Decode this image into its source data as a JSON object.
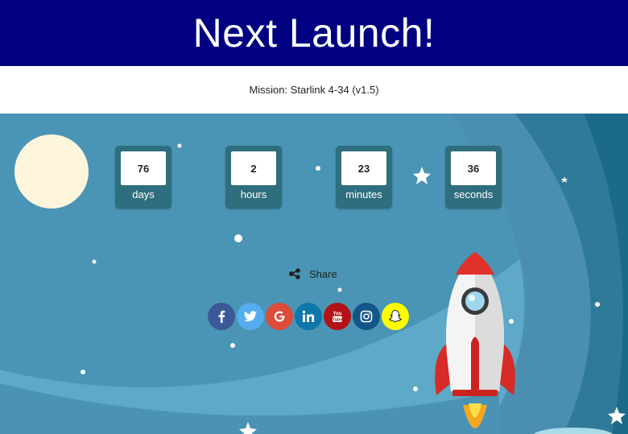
{
  "header": {
    "title": "Next Launch!"
  },
  "mission": {
    "text": "Mission: Starlink 4-34 (v1.5)"
  },
  "countdown": [
    {
      "value": "76",
      "unit": "days"
    },
    {
      "value": "2",
      "unit": "hours"
    },
    {
      "value": "23",
      "unit": "minutes"
    },
    {
      "value": "36",
      "unit": "seconds"
    }
  ],
  "share": {
    "label": "Share",
    "icon": "share-icon"
  },
  "social": [
    {
      "name": "facebook",
      "icon": "facebook-icon",
      "color": "#3b5998"
    },
    {
      "name": "twitter",
      "icon": "twitter-icon",
      "color": "#55acee"
    },
    {
      "name": "google",
      "icon": "google-icon",
      "color": "#dd4b39"
    },
    {
      "name": "linkedin",
      "icon": "linkedin-icon",
      "color": "#0e76a8"
    },
    {
      "name": "youtube",
      "icon": "youtube-icon",
      "color": "#b31217"
    },
    {
      "name": "instagram",
      "icon": "instagram-icon",
      "color": "#125688"
    },
    {
      "name": "snapchat",
      "icon": "snapchat-icon",
      "color": "#fffc00"
    }
  ],
  "colors": {
    "header_bg": "#000080",
    "sky": "#5ea8c8",
    "counter_bg": "#2e6e7e",
    "moon": "#fdf6dc",
    "rocket_red": "#e0302a"
  }
}
